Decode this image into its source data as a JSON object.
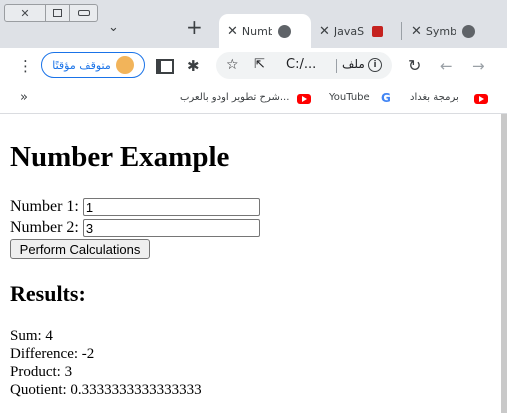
{
  "tabs": [
    {
      "title": "Numb",
      "favicon": "globe-icon",
      "active": true
    },
    {
      "title": "JavaS",
      "favicon": "youtube-icon",
      "active": false
    },
    {
      "title": "Symb",
      "favicon": "globe-icon",
      "active": false
    }
  ],
  "toolbar": {
    "paused_label": "متوقف مؤقتًا",
    "url": "C:/...",
    "file_label": "ملف"
  },
  "bookmarks": [
    {
      "label": "برمجة بغداد",
      "icon": "youtube-icon"
    },
    {
      "label": "YouTube",
      "icon": "google-icon"
    },
    {
      "label": "شرح تطوير اودو بالعرب...",
      "icon": "youtube-icon"
    }
  ],
  "page": {
    "title": "Number Example",
    "number1_label": "Number 1:",
    "number1_value": "1",
    "number2_label": "Number 2:",
    "number2_value": "3",
    "button_label": "Perform Calculations",
    "results_title": "Results:",
    "sum": "Sum: 4",
    "difference": "Difference: -2",
    "product": "Product: 3",
    "quotient": "Quotient: 0.3333333333333333"
  },
  "colors": {
    "tabstrip": "#dee1e6",
    "accent": "#1a73e8",
    "youtube_red": "#ff0000"
  }
}
